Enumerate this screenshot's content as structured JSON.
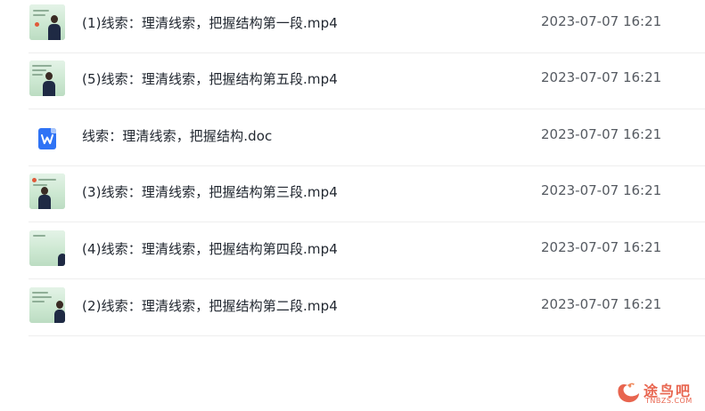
{
  "files": [
    {
      "name": "(1)线索：理清线索，把握结构第一段.mp4",
      "date": "2023-07-07 16:21",
      "type": "video",
      "icon": "video-thumbnail-icon"
    },
    {
      "name": "(5)线索：理清线索，把握结构第五段.mp4",
      "date": "2023-07-07 16:21",
      "type": "video",
      "icon": "video-thumbnail-icon"
    },
    {
      "name": "线索：理清线索，把握结构.doc",
      "date": "2023-07-07 16:21",
      "type": "doc",
      "icon": "word-doc-icon"
    },
    {
      "name": "(3)线索：理清线索，把握结构第三段.mp4",
      "date": "2023-07-07 16:21",
      "type": "video",
      "icon": "video-thumbnail-icon"
    },
    {
      "name": "(4)线索：理清线索，把握结构第四段.mp4",
      "date": "2023-07-07 16:21",
      "type": "video",
      "icon": "video-thumbnail-icon"
    },
    {
      "name": "(2)线索：理清线索，把握结构第二段.mp4",
      "date": "2023-07-07 16:21",
      "type": "video",
      "icon": "video-thumbnail-icon"
    }
  ],
  "watermark": {
    "title": "途鸟吧",
    "subtitle": "TNBZS.COM"
  },
  "colors": {
    "doc_icon": "#2f73f5",
    "watermark": "#e8654f",
    "divider": "#eeeeee"
  }
}
